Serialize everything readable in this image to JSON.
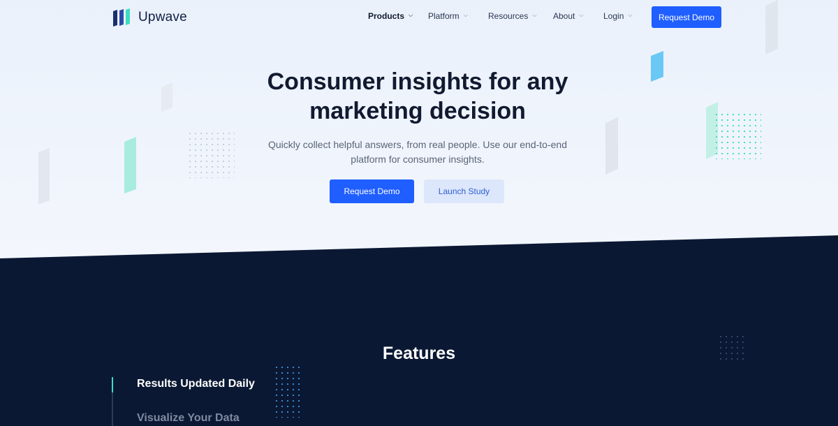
{
  "brand": {
    "name": "Upwave"
  },
  "nav": {
    "items": [
      {
        "label": "Products"
      },
      {
        "label": "Platform"
      },
      {
        "label": "Resources"
      },
      {
        "label": "About"
      },
      {
        "label": "Login"
      }
    ],
    "cta_label": "Request Demo"
  },
  "hero": {
    "title_line1": "Consumer insights for any",
    "title_line2": "marketing decision",
    "subtitle_line1": "Quickly collect helpful answers, from real people. Use our end-to-end",
    "subtitle_line2": "platform for consumer insights.",
    "primary_button": "Request Demo",
    "secondary_button": "Launch Study"
  },
  "features": {
    "title": "Features",
    "items": [
      {
        "label": "Results Updated Daily",
        "active": true
      },
      {
        "label": "Visualize Your Data",
        "active": false
      }
    ]
  },
  "colors": {
    "accent": "#1f5eff",
    "dark_bg": "#0a1833",
    "teal": "#3ddcc0",
    "sky": "#5bc4f5"
  }
}
